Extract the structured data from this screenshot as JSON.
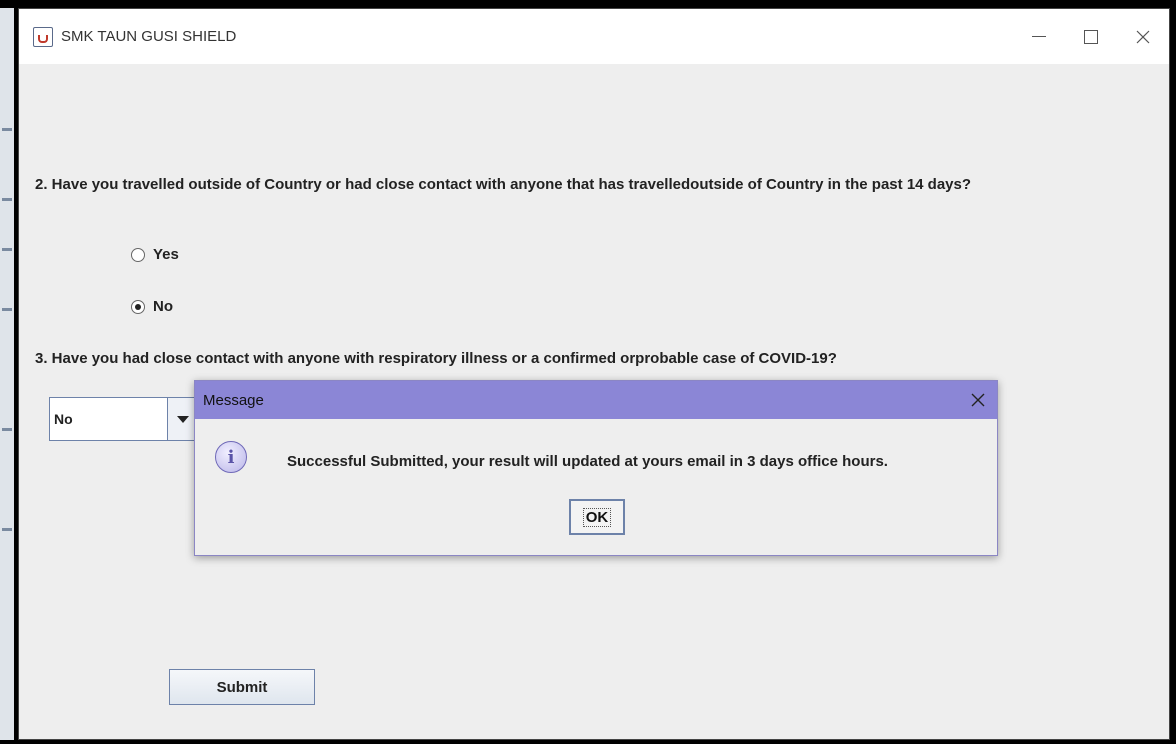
{
  "window": {
    "title": "SMK TAUN GUSI SHIELD",
    "icon": "java-cup-icon"
  },
  "form": {
    "question2": "2. Have you travelled outside of Country or had close contact with anyone that has travelledoutside of Country in the past 14 days?",
    "option_yes": "Yes",
    "option_no": "No",
    "selected_q2": "No",
    "question3": "3. Have you had close contact with anyone with respiratory illness or a confirmed orprobable case of COVID-19?",
    "q3_selected": "No",
    "submit_label": "Submit"
  },
  "dialog": {
    "title": "Message",
    "icon": "info-icon",
    "message": "Successful Submitted, your result will updated at yours email in 3 days office hours.",
    "ok_label": "OK"
  }
}
